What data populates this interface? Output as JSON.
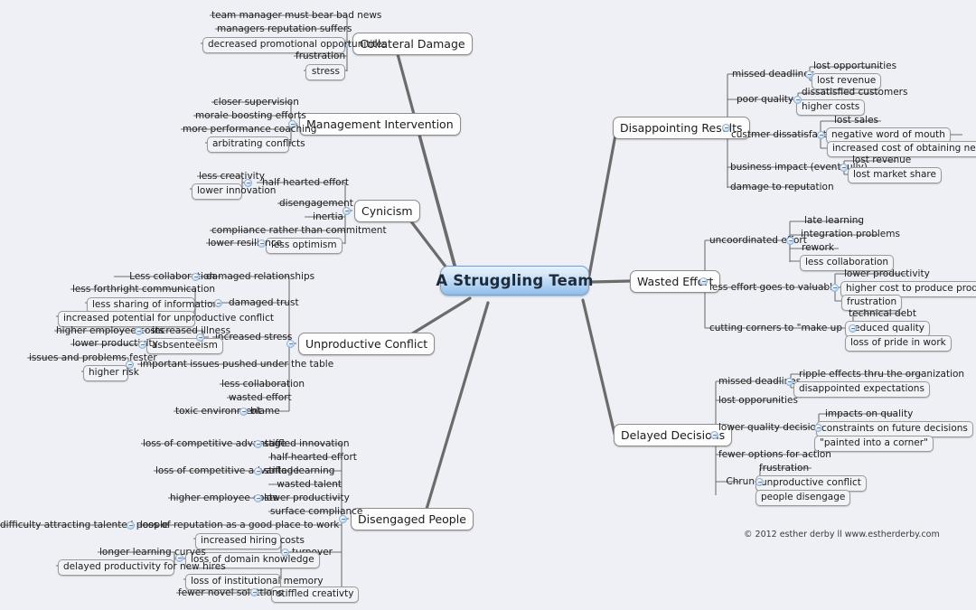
{
  "meta": {
    "root": "A Struggling Team",
    "credit": "© 2012 esther derby  ll  www.estherderby.com",
    "colors": {
      "background": "#eef0f5",
      "root_fill_top": "#e8f2fb",
      "root_fill_bottom": "#8fbde9",
      "root_border": "#7e9fc4",
      "node_fill": "#fdfdfd",
      "node_border": "#8d8d8d",
      "line": "#6b6b6b",
      "toggle_fill": "#aac8e6",
      "text": "#1b1b1b"
    },
    "icons": {
      "toggle": "collapse-minus-icon"
    }
  },
  "branches": {
    "collateral_damage": {
      "label": "Collateral Damage",
      "children": [
        "team manager must bear bad news",
        "managers reputation suffers",
        "decreased promotional opportunitites",
        "frustration",
        "stress"
      ]
    },
    "management_intervention": {
      "label": "Management Intervention",
      "children": [
        "closer supervision",
        "morale boosting efforts",
        "more performance coaching",
        "arbitrating conflicts"
      ]
    },
    "cynicism": {
      "label": "Cynicism",
      "children": [
        "half hearted effort",
        "disengagement",
        "inertia",
        "compliance rather than commitment",
        "less optimism"
      ],
      "grandchildren": {
        "half_hearted_effort": [
          "less creativity",
          "lower innovation"
        ],
        "less_optimism": [
          "lower resiliance"
        ]
      }
    },
    "unproductive_conflict": {
      "label": "Unproductive Conflict",
      "children": [
        "damaged relationships",
        "damaged trust",
        "increased stress",
        "important issues pushed under the table",
        "less collaboration",
        "wasted effort",
        "blame"
      ],
      "grandchildren": {
        "damaged_relationships": [
          "Less collaboration"
        ],
        "damaged_trust": [
          "less forthright communication",
          "less sharing of information",
          "increased potential for unproductive conflict"
        ],
        "increased_stress": [
          "increased illness",
          "asbsenteeism"
        ],
        "increased_illness": [
          "higher employee costs"
        ],
        "asbsenteeism": [
          "lower productivity"
        ],
        "important_issues": [
          "issues and problems fester",
          "higher risk"
        ],
        "blame": [
          "toxic environment"
        ]
      }
    },
    "disengaged_people": {
      "label": "Disengaged People",
      "children": [
        "stiffled innovation",
        "half-hearted effort",
        "stifled learning",
        "wasted talent",
        "lower productivity",
        "surface compliance",
        "loss of reputation as a good place to work",
        "turnover",
        "stiffled creativty"
      ],
      "grandchildren": {
        "stiffled_innovation": [
          "loss of competitive advantage"
        ],
        "stifled_learning": [
          "loss of competitive advantage"
        ],
        "lower_productivity": [
          "higher employee costs"
        ],
        "loss_of_reputation": [
          "difficulty attracting talented people"
        ],
        "turnover": [
          "increased hiring costs",
          "loss of domain knowledge",
          "loss of institutional memory"
        ],
        "loss_of_domain_knowledge": [
          "longer learning curves",
          "delayed productivity for new hires"
        ],
        "stiffled_creativty": [
          "fewer novel soluttions"
        ]
      }
    },
    "disappointing_results": {
      "label": "Disappointing Results",
      "children": [
        "missed deadlines",
        "poor quality",
        "custmer dissatisfaction",
        "business impact (eventaully)",
        "damage to reputation"
      ],
      "grandchildren": {
        "missed_deadlines": [
          "lost opportunities",
          "lost revenue"
        ],
        "poor_quality": [
          "dissatisfied customers",
          "higher costs"
        ],
        "custmer_dissatisfaction": [
          "lost sales",
          "negative word of mouth",
          "increased cost of obtaining new customers"
        ],
        "business_impact": [
          "lost revenue",
          "lost market share"
        ]
      }
    },
    "wasted_effort": {
      "label": "Wasted Effort",
      "children": [
        "uncoordinated effort",
        "less effort goes to valuable work",
        "cutting corners to \"make up time\""
      ],
      "grandchildren": {
        "uncoordinated_effort": [
          "late learning",
          "integration problems",
          "rework",
          "less collaboration"
        ],
        "less_effort": [
          "lower productivity",
          "higher cost to produce products",
          "frustration"
        ],
        "cutting_corners": [
          "technical debt",
          "reduced quality",
          "loss of pride in work"
        ]
      }
    },
    "delayed_decisions": {
      "label": "Delayed Decisions",
      "children": [
        "missed deadlines",
        "lost opporunities",
        "lower quality decisions",
        "fewer options for action",
        "Chrun"
      ],
      "grandchildren": {
        "missed_deadlines": [
          "ripple effects thru the organization",
          "disappointed expectations"
        ],
        "lower_quality_decisions": [
          "impacts on quality",
          "constraints on future decisions",
          "\"painted into a corner\""
        ],
        "chrun": [
          "frustration",
          "unproductive conflict",
          "people disengage"
        ]
      }
    }
  }
}
